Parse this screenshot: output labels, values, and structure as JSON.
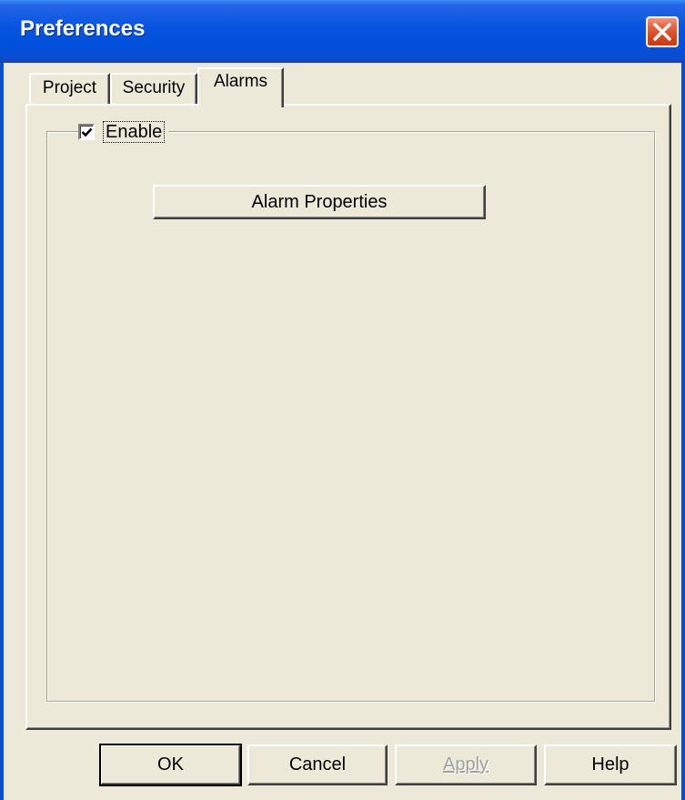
{
  "window": {
    "title": "Preferences"
  },
  "tabs": [
    {
      "label": "Project",
      "active": false
    },
    {
      "label": "Security",
      "active": false
    },
    {
      "label": "Alarms",
      "active": true
    }
  ],
  "alarms_panel": {
    "enable_label": "Enable",
    "enable_checked": true,
    "alarm_properties_label": "Alarm Properties"
  },
  "footer": {
    "ok_label": "OK",
    "cancel_label": "Cancel",
    "apply_label": "Apply",
    "apply_enabled": false,
    "help_label": "Help"
  },
  "colors": {
    "titlebar": "#0a55e0",
    "dialog_bg": "#ece9d8",
    "close_button": "#d8451f"
  }
}
